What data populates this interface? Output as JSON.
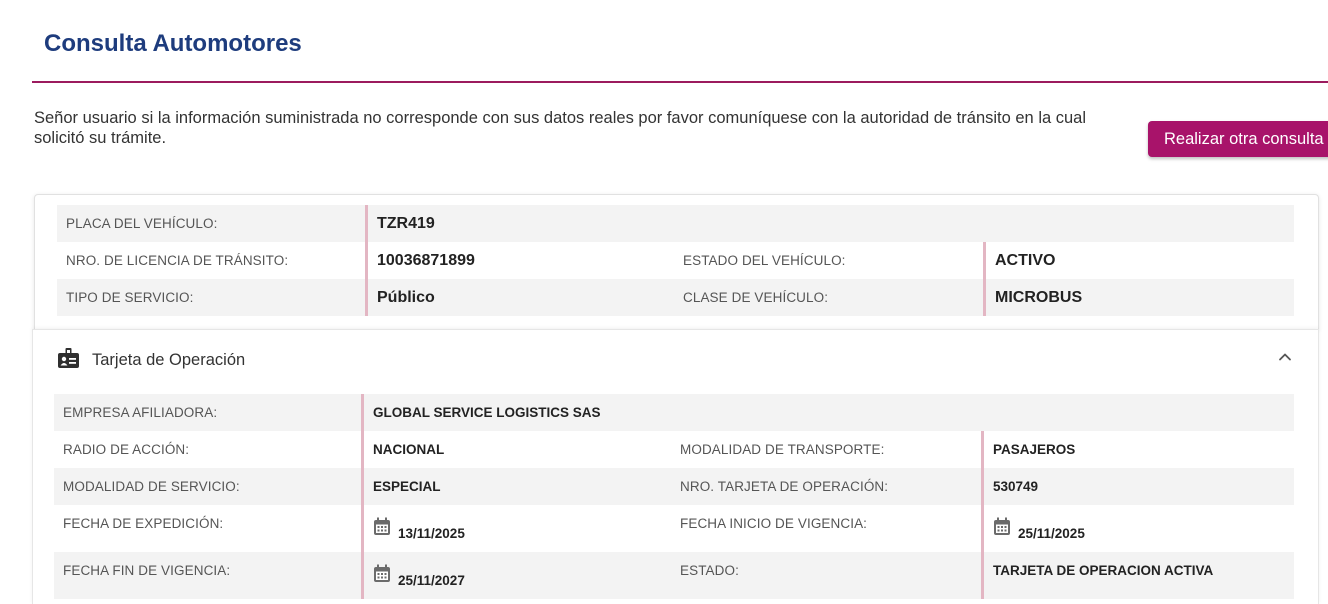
{
  "page": {
    "title": "Consulta Automotores",
    "notice": "Señor usuario si la información suministrada no corresponde con sus datos reales por favor comuníquese con la autoridad de tránsito en la cual solicitó su trámite.",
    "new_query_button": "Realizar otra consulta"
  },
  "vehicle": {
    "plate_label": "PLACA DEL VEHÍCULO:",
    "plate_value": "TZR419",
    "license_label": "NRO. DE LICENCIA DE TRÁNSITO:",
    "license_value": "10036871899",
    "status_label": "ESTADO DEL VEHÍCULO:",
    "status_value": "ACTIVO",
    "service_label": "TIPO DE SERVICIO:",
    "service_value": "Público",
    "class_label": "CLASE DE VEHÍCULO:",
    "class_value": "MICROBUS"
  },
  "operation_card": {
    "section_title": "Tarjeta de Operación",
    "section_icon": "id-badge-icon",
    "collapse_icon": "chevron-up-icon",
    "company_label": "EMPRESA AFILIADORA:",
    "company_value": "GLOBAL SERVICE LOGISTICS SAS",
    "radius_label": "RADIO DE ACCIÓN:",
    "radius_value": "NACIONAL",
    "transport_mode_label": "MODALIDAD DE TRANSPORTE:",
    "transport_mode_value": "PASAJEROS",
    "service_mode_label": "MODALIDAD DE SERVICIO:",
    "service_mode_value": "ESPECIAL",
    "card_number_label": "NRO. TARJETA DE OPERACIÓN:",
    "card_number_value": "530749",
    "issue_date_label": "FECHA DE EXPEDICIÓN:",
    "issue_date_value": "13/11/2025",
    "start_date_label": "FECHA INICIO DE VIGENCIA:",
    "start_date_value": "25/11/2025",
    "end_date_label": "FECHA FIN DE VIGENCIA:",
    "end_date_value": "25/11/2027",
    "state_label": "ESTADO:",
    "state_value": "TARJETA DE OPERACION ACTIVA",
    "date_icon": "calendar-icon"
  },
  "colors": {
    "title": "#1e3c7d",
    "accent": "#a8136a",
    "rule": "#9c1b5e",
    "value_border": "#e3b6c3",
    "row_shade": "#f3f3f3"
  }
}
